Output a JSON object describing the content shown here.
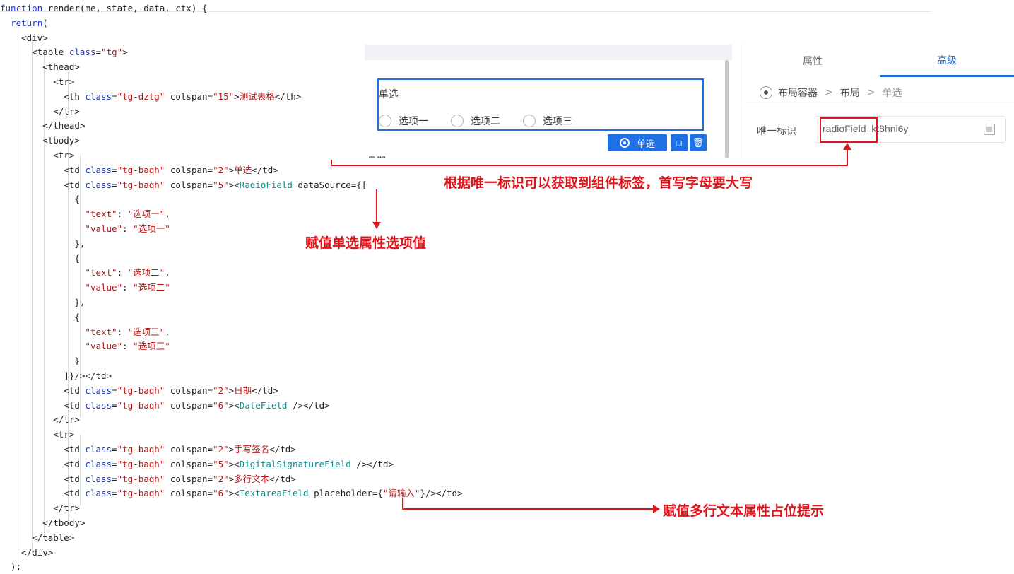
{
  "code": {
    "lines": [
      {
        "seg": [
          [
            "kw",
            "function"
          ],
          [
            "tag",
            " render(me, state, data, ctx) "
          ],
          [
            "tag",
            "{"
          ]
        ]
      },
      {
        "seg": [
          [
            "tag",
            "  "
          ],
          [
            "kw",
            "return"
          ],
          [
            "tag",
            "("
          ]
        ]
      },
      {
        "seg": [
          [
            "tag",
            "    <div>"
          ]
        ]
      },
      {
        "seg": [
          [
            "tag",
            "      <table "
          ],
          [
            "attr",
            "class"
          ],
          [
            "tag",
            "="
          ],
          [
            "str",
            "\"tg\""
          ],
          [
            "tag",
            ">"
          ]
        ]
      },
      {
        "seg": [
          [
            "tag",
            "        <thead>"
          ]
        ]
      },
      {
        "seg": [
          [
            "tag",
            "          <tr>"
          ]
        ]
      },
      {
        "seg": [
          [
            "tag",
            "            <th "
          ],
          [
            "attr",
            "class"
          ],
          [
            "tag",
            "="
          ],
          [
            "str",
            "\"tg-dztg\""
          ],
          [
            "tag",
            " colspan="
          ],
          [
            "str",
            "\"15\""
          ],
          [
            "tag",
            ">"
          ],
          [
            "str",
            "测试表格"
          ],
          [
            "tag",
            "</th>"
          ]
        ]
      },
      {
        "seg": [
          [
            "tag",
            "          </tr>"
          ]
        ]
      },
      {
        "seg": [
          [
            "tag",
            "        </thead>"
          ]
        ]
      },
      {
        "seg": [
          [
            "tag",
            "        <tbody>"
          ]
        ]
      },
      {
        "seg": [
          [
            "tag",
            "          <tr>"
          ]
        ]
      },
      {
        "seg": [
          [
            "tag",
            "            <td "
          ],
          [
            "attr",
            "class"
          ],
          [
            "tag",
            "="
          ],
          [
            "str",
            "\"tg-baqh\""
          ],
          [
            "tag",
            " colspan="
          ],
          [
            "str",
            "\"2\""
          ],
          [
            "tag",
            ">"
          ],
          [
            "str",
            "单选"
          ],
          [
            "tag",
            "</td>"
          ]
        ]
      },
      {
        "seg": [
          [
            "tag",
            "            <td "
          ],
          [
            "attr",
            "class"
          ],
          [
            "tag",
            "="
          ],
          [
            "str",
            "\"tg-baqh\""
          ],
          [
            "tag",
            " colspan="
          ],
          [
            "str",
            "\"5\""
          ],
          [
            "tag",
            ">"
          ],
          [
            "tag",
            "<"
          ],
          [
            "cmp",
            "RadioField"
          ],
          [
            "tag",
            " dataSource={["
          ]
        ]
      },
      {
        "seg": [
          [
            "tag",
            "              {"
          ]
        ]
      },
      {
        "seg": [
          [
            "tag",
            "                "
          ],
          [
            "str",
            "\"text\""
          ],
          [
            "tag",
            ": "
          ],
          [
            "str",
            "\"选项一\""
          ],
          [
            "tag",
            ","
          ]
        ]
      },
      {
        "seg": [
          [
            "tag",
            "                "
          ],
          [
            "str",
            "\"value\""
          ],
          [
            "tag",
            ": "
          ],
          [
            "str",
            "\"选项一\""
          ]
        ]
      },
      {
        "seg": [
          [
            "tag",
            "              },"
          ]
        ]
      },
      {
        "seg": [
          [
            "tag",
            "              {"
          ]
        ]
      },
      {
        "seg": [
          [
            "tag",
            "                "
          ],
          [
            "str",
            "\"text\""
          ],
          [
            "tag",
            ": "
          ],
          [
            "str",
            "\"选项二\""
          ],
          [
            "tag",
            ","
          ]
        ]
      },
      {
        "seg": [
          [
            "tag",
            "                "
          ],
          [
            "str",
            "\"value\""
          ],
          [
            "tag",
            ": "
          ],
          [
            "str",
            "\"选项二\""
          ]
        ]
      },
      {
        "seg": [
          [
            "tag",
            "              },"
          ]
        ]
      },
      {
        "seg": [
          [
            "tag",
            "              {"
          ]
        ]
      },
      {
        "seg": [
          [
            "tag",
            "                "
          ],
          [
            "str",
            "\"text\""
          ],
          [
            "tag",
            ": "
          ],
          [
            "str",
            "\"选项三\""
          ],
          [
            "tag",
            ","
          ]
        ]
      },
      {
        "seg": [
          [
            "tag",
            "                "
          ],
          [
            "str",
            "\"value\""
          ],
          [
            "tag",
            ": "
          ],
          [
            "str",
            "\"选项三\""
          ]
        ]
      },
      {
        "seg": [
          [
            "tag",
            "              }"
          ]
        ]
      },
      {
        "seg": [
          [
            "tag",
            "            ]}/></td>"
          ]
        ]
      },
      {
        "seg": [
          [
            "tag",
            "            <td "
          ],
          [
            "attr",
            "class"
          ],
          [
            "tag",
            "="
          ],
          [
            "str",
            "\"tg-baqh\""
          ],
          [
            "tag",
            " colspan="
          ],
          [
            "str",
            "\"2\""
          ],
          [
            "tag",
            ">"
          ],
          [
            "str",
            "日期"
          ],
          [
            "tag",
            "</td>"
          ]
        ]
      },
      {
        "seg": [
          [
            "tag",
            "            <td "
          ],
          [
            "attr",
            "class"
          ],
          [
            "tag",
            "="
          ],
          [
            "str",
            "\"tg-baqh\""
          ],
          [
            "tag",
            " colspan="
          ],
          [
            "str",
            "\"6\""
          ],
          [
            "tag",
            ">"
          ],
          [
            "tag",
            "<"
          ],
          [
            "cmp",
            "DateField"
          ],
          [
            "tag",
            " /></td>"
          ]
        ]
      },
      {
        "seg": [
          [
            "tag",
            "          </tr>"
          ]
        ]
      },
      {
        "seg": [
          [
            "tag",
            "          <tr>"
          ]
        ]
      },
      {
        "seg": [
          [
            "tag",
            "            <td "
          ],
          [
            "attr",
            "class"
          ],
          [
            "tag",
            "="
          ],
          [
            "str",
            "\"tg-baqh\""
          ],
          [
            "tag",
            " colspan="
          ],
          [
            "str",
            "\"2\""
          ],
          [
            "tag",
            ">"
          ],
          [
            "str",
            "手写签名"
          ],
          [
            "tag",
            "</td>"
          ]
        ]
      },
      {
        "seg": [
          [
            "tag",
            "            <td "
          ],
          [
            "attr",
            "class"
          ],
          [
            "tag",
            "="
          ],
          [
            "str",
            "\"tg-baqh\""
          ],
          [
            "tag",
            " colspan="
          ],
          [
            "str",
            "\"5\""
          ],
          [
            "tag",
            ">"
          ],
          [
            "tag",
            "<"
          ],
          [
            "cmp",
            "DigitalSignatureField"
          ],
          [
            "tag",
            " /></td>"
          ]
        ]
      },
      {
        "seg": [
          [
            "tag",
            "            <td "
          ],
          [
            "attr",
            "class"
          ],
          [
            "tag",
            "="
          ],
          [
            "str",
            "\"tg-baqh\""
          ],
          [
            "tag",
            " colspan="
          ],
          [
            "str",
            "\"2\""
          ],
          [
            "tag",
            ">"
          ],
          [
            "str",
            "多行文本"
          ],
          [
            "tag",
            "</td>"
          ]
        ]
      },
      {
        "seg": [
          [
            "tag",
            "            <td "
          ],
          [
            "attr",
            "class"
          ],
          [
            "tag",
            "="
          ],
          [
            "str",
            "\"tg-baqh\""
          ],
          [
            "tag",
            " colspan="
          ],
          [
            "str",
            "\"6\""
          ],
          [
            "tag",
            ">"
          ],
          [
            "tag",
            "<"
          ],
          [
            "cmp",
            "TextareaField"
          ],
          [
            "tag",
            " placeholder={"
          ],
          [
            "str",
            "\"请输入\""
          ],
          [
            "tag",
            "}/></td>"
          ]
        ]
      },
      {
        "seg": [
          [
            "tag",
            "          </tr>"
          ]
        ]
      },
      {
        "seg": [
          [
            "tag",
            "        </tbody>"
          ]
        ]
      },
      {
        "seg": [
          [
            "tag",
            "      </table>"
          ]
        ]
      },
      {
        "seg": [
          [
            "tag",
            "    </div>"
          ]
        ]
      },
      {
        "seg": [
          [
            "tag",
            "  );"
          ]
        ]
      }
    ]
  },
  "designer": {
    "radio_label": "单选",
    "options": [
      "选项一",
      "选项二",
      "选项三"
    ],
    "component_tag": "单选",
    "next_field_label": "日期"
  },
  "panel": {
    "tabs": [
      "属性",
      "高级"
    ],
    "active_tab": "高级",
    "breadcrumb": [
      "布局容器",
      "布局",
      "单选"
    ],
    "uid_label": "唯一标识",
    "uid_value": "radioField_kt8hni6y"
  },
  "annotations": {
    "uid_note": "根据唯一标识可以获取到组件标签，首写字母要大写",
    "datasource_note": "赋值单选属性选项值",
    "placeholder_note": "赋值多行文本属性占位提示"
  },
  "colors": {
    "accent": "#1f6fe5",
    "annotation_red": "#e0141a",
    "keyword": "#1a3bc7",
    "string": "#b01818",
    "component": "#0d8c8c"
  }
}
